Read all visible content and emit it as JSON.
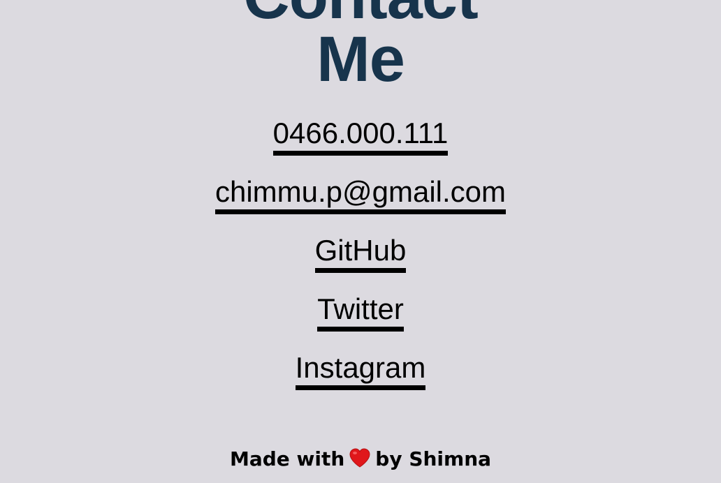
{
  "header": {
    "title_line_1": "Contact",
    "title_line_2": "Me"
  },
  "contact": {
    "phone": "0466.000.111",
    "email": "chimmu.p@gmail.com",
    "github": "GitHub",
    "twitter": "Twitter",
    "instagram": "Instagram"
  },
  "footer": {
    "prefix": "Made with",
    "icon": "heart-icon",
    "suffix": "by Shimna"
  },
  "colors": {
    "background": "#dcdae0",
    "heading": "#17344c",
    "link": "#000000",
    "heart": "#e0171b"
  }
}
